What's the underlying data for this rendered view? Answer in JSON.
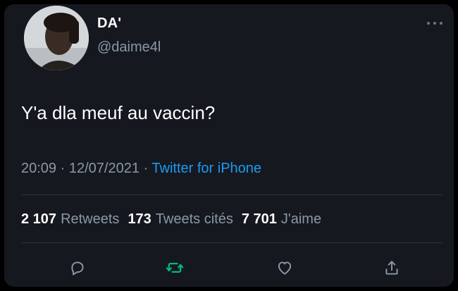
{
  "tweet": {
    "display_name": "DA'",
    "handle": "@daime4l",
    "text": "Y'a dla meuf au vaccin?",
    "time": "20:09",
    "separator": "·",
    "date": "12/07/2021",
    "source": "Twitter for iPhone"
  },
  "stats": {
    "retweets_count": "2 107",
    "retweets_label": "Retweets",
    "quotes_count": "173",
    "quotes_label": "Tweets cités",
    "likes_count": "7 701",
    "likes_label": "J'aime"
  },
  "icons": {
    "more": "more-dots-icon",
    "reply": "reply-bubble-icon",
    "retweet": "retweet-icon",
    "like": "heart-icon",
    "share": "share-icon"
  },
  "colors": {
    "background": "#15181f",
    "text_primary": "#ffffff",
    "text_secondary": "#8b98a5",
    "link": "#1d9bf0",
    "retweet_active": "#00ba7c",
    "divider": "#2f3336"
  }
}
